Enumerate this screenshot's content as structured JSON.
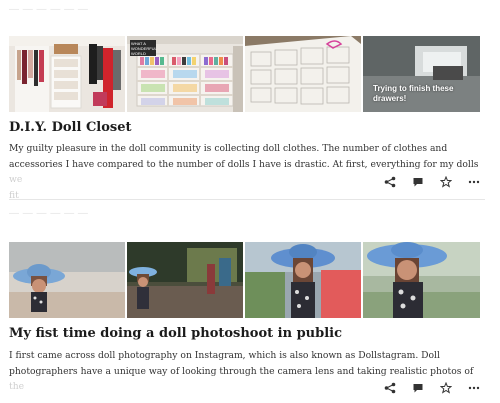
{
  "post1": {
    "faded_header": "— — — — — —",
    "title": "D.I.Y. Doll Closet",
    "excerpt_line1": "My guilty pleasure in the doll community is collecting doll clothes. The number of clothes and",
    "excerpt_line2_main": "accessories I have compared to the number of dolls I have is drastic. At first, everything for my dolls",
    "excerpt_line2_fade": " we",
    "excerpt_line3_fade": "fit",
    "image_overlay_text": "Trying to finish these drawers!",
    "image_sign_text": "WHAT A WONDERFUL WORLD"
  },
  "post2": {
    "faded_header": "— — — — — —",
    "title": "My fist time doing a doll photoshoot in public",
    "excerpt_line1": "I first came across doll photography on Instagram, which is also known as Dollstagram. Doll",
    "excerpt_line2": "photographers have a unique way of looking through the camera lens and taking realistic photos of",
    "excerpt_line3_fade": "the"
  },
  "actions": {
    "share": "share-icon",
    "comment": "comment-icon",
    "favorite": "star-icon",
    "more": "more-icon"
  },
  "colors": {
    "background": "#ffffff",
    "text": "#1f1f1f",
    "divider": "#e6e6e6"
  }
}
